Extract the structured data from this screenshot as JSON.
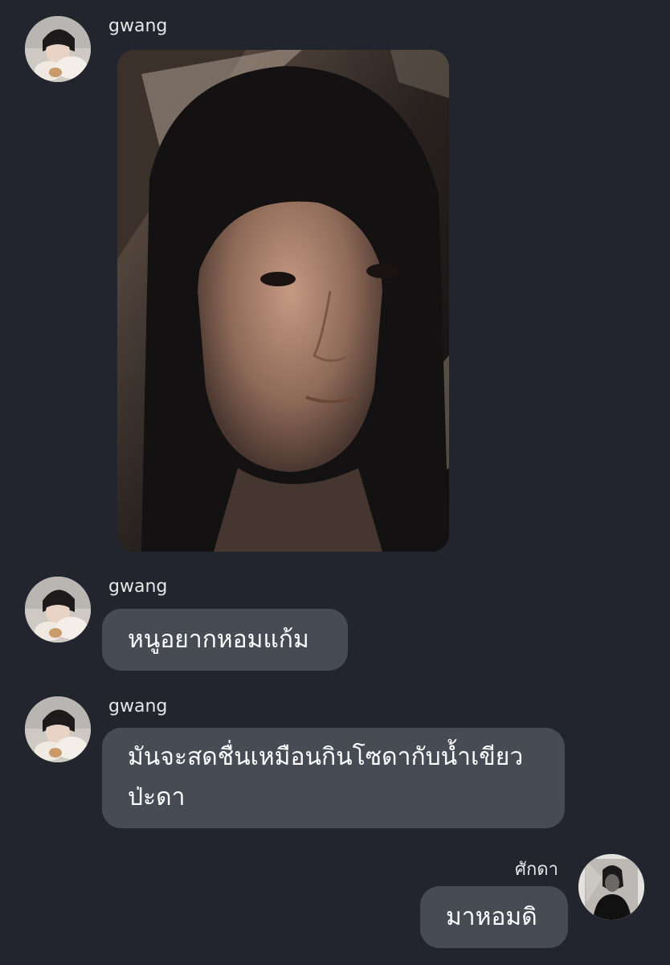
{
  "messages": [
    {
      "sender": "gwang",
      "type": "image",
      "avatar": "person-holding-dog-avatar",
      "image": "selfie-photo-hooded-person"
    },
    {
      "sender": "gwang",
      "type": "text",
      "avatar": "person-holding-dog-avatar",
      "text": "หนูอยากหอมแก้ม"
    },
    {
      "sender": "gwang",
      "type": "text",
      "avatar": "person-holding-dog-avatar",
      "text_lines": [
        "มันจะสดชื่นเหมือนกินโซดากับน้ำเขียว",
        "ป่ะดา"
      ]
    },
    {
      "sender": "ศักดา",
      "type": "text",
      "avatar": "dark-portrait-avatar",
      "outgoing": true,
      "text": "มาหอมดิ"
    }
  ],
  "colors": {
    "background": "#22252d",
    "bubble": "#464b54",
    "text": "#ffffff",
    "name": "#e6e6e6"
  }
}
